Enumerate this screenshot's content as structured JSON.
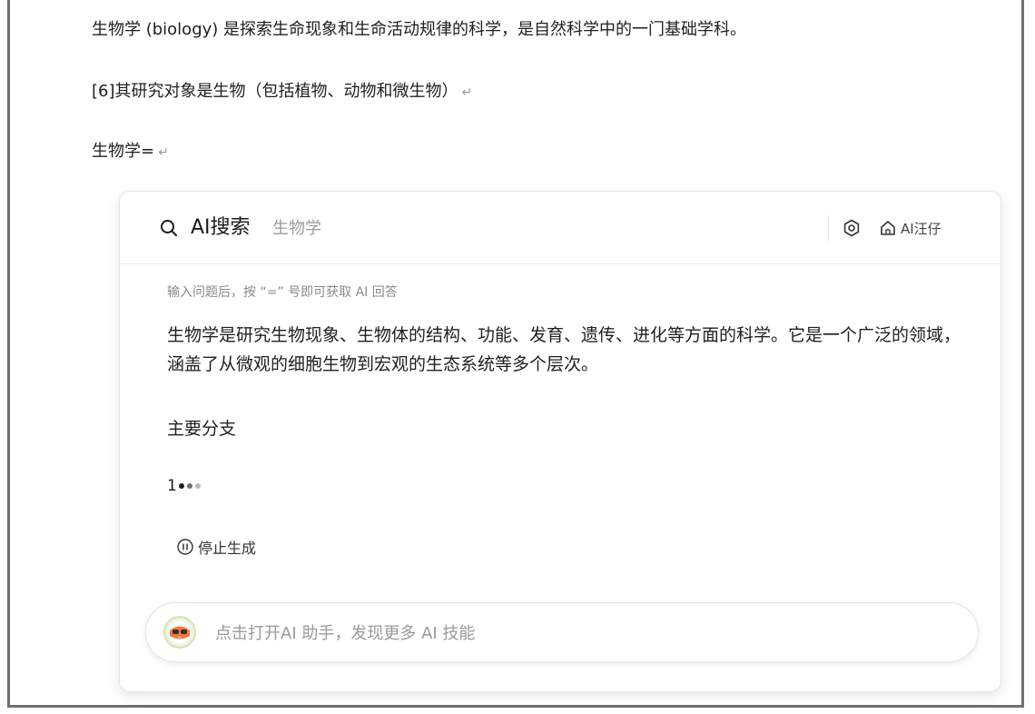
{
  "document": {
    "line1": "生物学 (biology) 是探索生命现象和生命活动规律的科学，是自然科学中的一门基础学科。",
    "line2": "[6]其研究对象是生物（包括植物、动物和微生物）",
    "line3": "生物学=",
    "return_mark": "↵"
  },
  "ai_panel": {
    "title": "AI搜索",
    "query": "生物学",
    "assistant_link": "AI汪仔",
    "hint": "输入问题后，按 “=” 号即可获取 AI 回答",
    "answer_paragraph": "生物学是研究生物现象、生物体的结构、功能、发育、遗传、进化等方面的科学。它是一个广泛的领域，涵盖了从微观的细胞生物到宏观的生态系统等多个层次。",
    "section_heading": "主要分支",
    "list_start": "1",
    "stop_label": "停止生成",
    "input_placeholder": "点击打开AI 助手，发现更多 AI 技能",
    "icons": {
      "search": "search-icon",
      "settings": "settings-icon",
      "home": "home-icon",
      "pause": "pause-icon",
      "avatar": "assistant-avatar"
    },
    "colors": {
      "dot_active": "#1f1f1f",
      "dot_mid": "#6f6f6f",
      "dot_faint": "#bdbdbd",
      "avatar_accent": "#f07a3a"
    }
  }
}
